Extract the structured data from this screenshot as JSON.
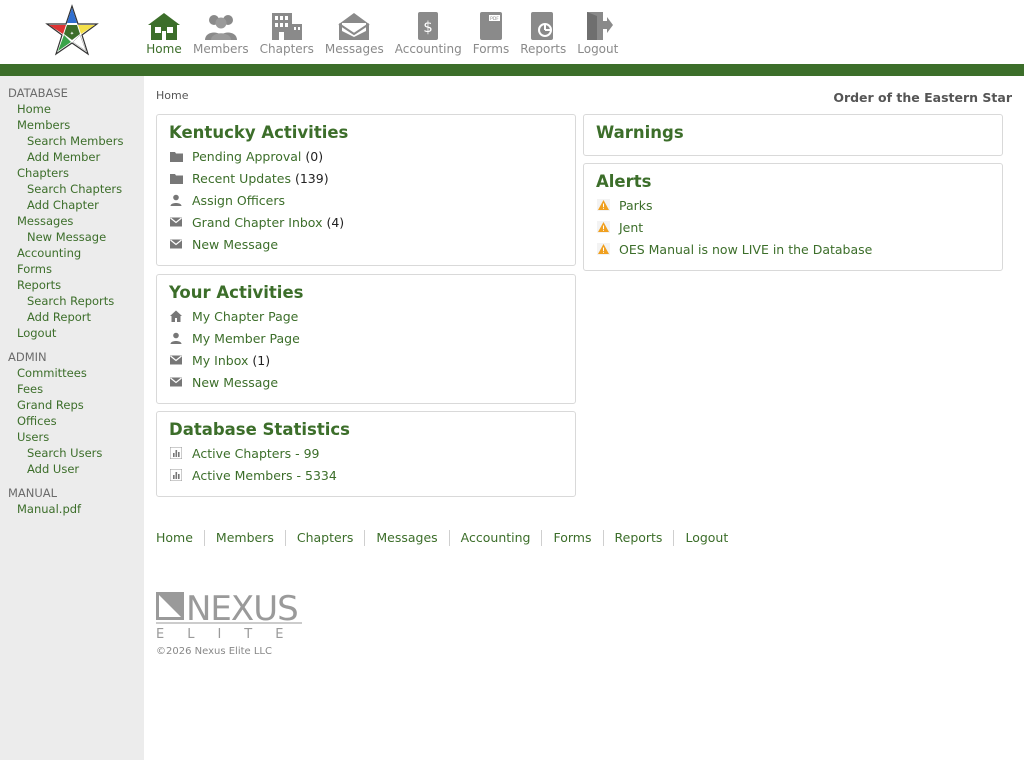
{
  "header": {
    "nav": [
      {
        "label": "Home",
        "icon": "home-icon",
        "active": true
      },
      {
        "label": "Members",
        "icon": "members-icon"
      },
      {
        "label": "Chapters",
        "icon": "chapters-icon"
      },
      {
        "label": "Messages",
        "icon": "messages-icon"
      },
      {
        "label": "Accounting",
        "icon": "accounting-icon"
      },
      {
        "label": "Forms",
        "icon": "forms-icon"
      },
      {
        "label": "Reports",
        "icon": "reports-icon"
      },
      {
        "label": "Logout",
        "icon": "logout-icon"
      }
    ],
    "brand_color": "#3c6e2a"
  },
  "sidebar": {
    "database": {
      "heading": "DATABASE",
      "items": [
        {
          "label": "Home",
          "level": 1
        },
        {
          "label": "Members",
          "level": 1
        },
        {
          "label": "Search Members",
          "level": 2
        },
        {
          "label": "Add Member",
          "level": 2
        },
        {
          "label": "Chapters",
          "level": 1
        },
        {
          "label": "Search Chapters",
          "level": 2
        },
        {
          "label": "Add Chapter",
          "level": 2
        },
        {
          "label": "Messages",
          "level": 1
        },
        {
          "label": "New Message",
          "level": 2
        },
        {
          "label": "Accounting",
          "level": 1
        },
        {
          "label": "Forms",
          "level": 1
        },
        {
          "label": "Reports",
          "level": 1
        },
        {
          "label": "Search Reports",
          "level": 2
        },
        {
          "label": "Add Report",
          "level": 2
        },
        {
          "label": "Logout",
          "level": 1
        }
      ]
    },
    "admin": {
      "heading": "ADMIN",
      "items": [
        {
          "label": "Committees",
          "level": 1
        },
        {
          "label": "Fees",
          "level": 1
        },
        {
          "label": "Grand Reps",
          "level": 1
        },
        {
          "label": "Offices",
          "level": 1
        },
        {
          "label": "Users",
          "level": 1
        },
        {
          "label": "Search Users",
          "level": 2
        },
        {
          "label": "Add User",
          "level": 2
        }
      ]
    },
    "manual": {
      "heading": "MANUAL",
      "items": [
        {
          "label": "Manual.pdf",
          "level": 1
        }
      ]
    }
  },
  "main": {
    "breadcrumb": "Home",
    "org_title": "Order of the Eastern Star",
    "kentucky": {
      "title": "Kentucky Activities",
      "rows": [
        {
          "icon": "folder-icon",
          "label": "Pending Approval",
          "count": "(0)"
        },
        {
          "icon": "folder-icon",
          "label": "Recent Updates",
          "count": "(139)"
        },
        {
          "icon": "person-icon",
          "label": "Assign Officers",
          "count": ""
        },
        {
          "icon": "envelope-icon",
          "label": "Grand Chapter Inbox",
          "count": "(4)"
        },
        {
          "icon": "envelope-icon",
          "label": "New Message",
          "count": ""
        }
      ]
    },
    "yours": {
      "title": "Your Activities",
      "rows": [
        {
          "icon": "home-icon",
          "label": "My Chapter Page",
          "count": ""
        },
        {
          "icon": "person-icon",
          "label": "My Member Page",
          "count": ""
        },
        {
          "icon": "envelope-icon",
          "label": "My Inbox",
          "count": "(1)"
        },
        {
          "icon": "envelope-icon",
          "label": "New Message",
          "count": ""
        }
      ]
    },
    "stats": {
      "title": "Database Statistics",
      "rows": [
        {
          "icon": "bar-chart-icon",
          "label": "Active Chapters - 99",
          "count": ""
        },
        {
          "icon": "bar-chart-icon",
          "label": "Active Members - 5334",
          "count": ""
        }
      ]
    },
    "warnings": {
      "title": "Warnings"
    },
    "alerts": {
      "title": "Alerts",
      "rows": [
        {
          "icon": "warning-icon",
          "label": "Parks",
          "count": ""
        },
        {
          "icon": "warning-icon",
          "label": "Jent",
          "count": ""
        },
        {
          "icon": "warning-icon",
          "label": "OES Manual is now LIVE in the Database",
          "count": ""
        }
      ]
    }
  },
  "footer": {
    "nav": [
      "Home",
      "Members",
      "Chapters",
      "Messages",
      "Accounting",
      "Forms",
      "Reports",
      "Logout"
    ],
    "brand_top": "NEXUS",
    "brand_bottom": "ELITE",
    "copyright": "©2026 Nexus Elite LLC"
  }
}
